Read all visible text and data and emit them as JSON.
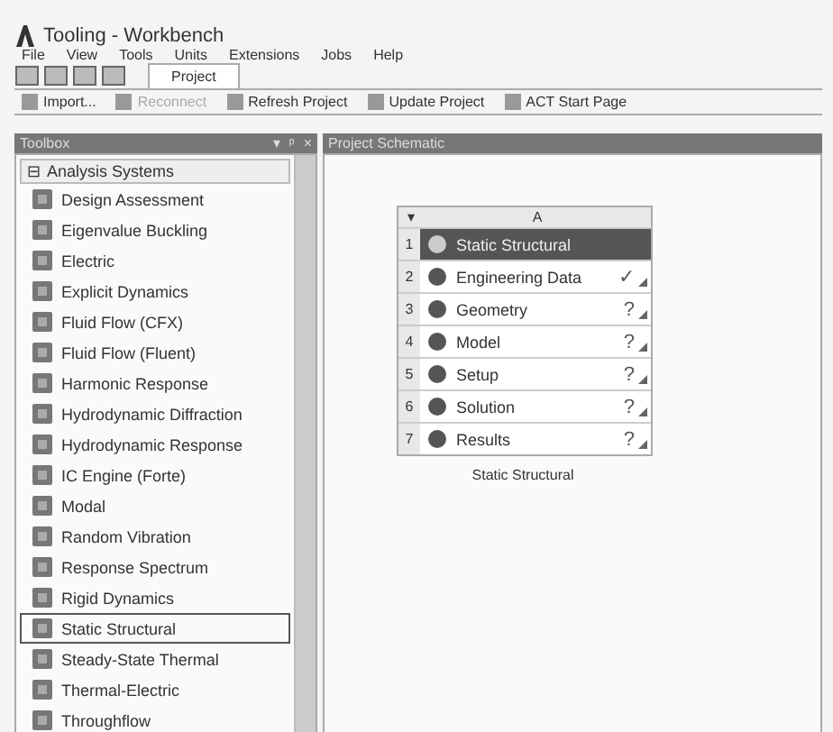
{
  "window": {
    "title": "Tooling - Workbench"
  },
  "menu": [
    "File",
    "View",
    "Tools",
    "Units",
    "Extensions",
    "Jobs",
    "Help"
  ],
  "tabs": [
    {
      "label": "Project",
      "selected": true
    }
  ],
  "toolbar": [
    {
      "label": "Import...",
      "disabled": false
    },
    {
      "label": "Reconnect",
      "disabled": true
    },
    {
      "label": "Refresh Project",
      "disabled": false
    },
    {
      "label": "Update Project",
      "disabled": false
    },
    {
      "label": "ACT Start Page",
      "disabled": false
    }
  ],
  "toolbox": {
    "title": "Toolbox",
    "controls": [
      "▾",
      "ᵖ",
      "×"
    ],
    "group": {
      "label": "Analysis Systems",
      "toggle": "⊟"
    },
    "items": [
      {
        "label": "Design Assessment",
        "selected": false
      },
      {
        "label": "Eigenvalue Buckling",
        "selected": false
      },
      {
        "label": "Electric",
        "selected": false
      },
      {
        "label": "Explicit Dynamics",
        "selected": false
      },
      {
        "label": "Fluid Flow (CFX)",
        "selected": false
      },
      {
        "label": "Fluid Flow (Fluent)",
        "selected": false
      },
      {
        "label": "Harmonic Response",
        "selected": false
      },
      {
        "label": "Hydrodynamic Diffraction",
        "selected": false
      },
      {
        "label": "Hydrodynamic Response",
        "selected": false
      },
      {
        "label": "IC Engine (Forte)",
        "selected": false
      },
      {
        "label": "Modal",
        "selected": false
      },
      {
        "label": "Random Vibration",
        "selected": false
      },
      {
        "label": "Response Spectrum",
        "selected": false
      },
      {
        "label": "Rigid Dynamics",
        "selected": false
      },
      {
        "label": "Static Structural",
        "selected": true
      },
      {
        "label": "Steady-State Thermal",
        "selected": false
      },
      {
        "label": "Thermal-Electric",
        "selected": false
      },
      {
        "label": "Throughflow",
        "selected": false
      }
    ]
  },
  "schematic": {
    "title": "Project Schematic",
    "system": {
      "caret": "▾",
      "column": "A",
      "name": "Static Structural",
      "rows": [
        {
          "num": "1",
          "label": "Static Structural",
          "kind": "header"
        },
        {
          "num": "2",
          "label": "Engineering Data",
          "kind": "cell",
          "status": "✓"
        },
        {
          "num": "3",
          "label": "Geometry",
          "kind": "cell",
          "status": "?"
        },
        {
          "num": "4",
          "label": "Model",
          "kind": "cell",
          "status": "?"
        },
        {
          "num": "5",
          "label": "Setup",
          "kind": "cell",
          "status": "?"
        },
        {
          "num": "6",
          "label": "Solution",
          "kind": "cell",
          "status": "?"
        },
        {
          "num": "7",
          "label": "Results",
          "kind": "cell",
          "status": "?"
        }
      ]
    }
  }
}
